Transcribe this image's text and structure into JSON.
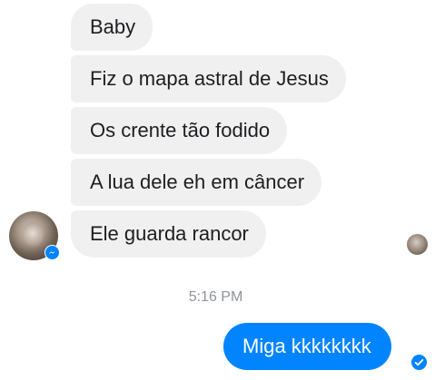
{
  "conversation": {
    "received_messages": [
      "Baby",
      "Fiz o mapa astral de Jesus",
      "Os crente tão fodido",
      "A lua dele eh em câncer",
      "Ele guarda rancor"
    ],
    "timestamp": "5:16 PM",
    "sent_messages": [
      "Miga kkkkkkkk"
    ]
  },
  "colors": {
    "received_bubble": "#f1f0f0",
    "sent_bubble": "#0084ff",
    "timestamp_text": "#90949c",
    "messenger_blue": "#0084ff"
  },
  "icons": {
    "contact_avatar": "avatar",
    "messenger_badge": "messenger-icon",
    "seen_indicator": "seen-avatar",
    "delivered_indicator": "check-circle-icon"
  }
}
